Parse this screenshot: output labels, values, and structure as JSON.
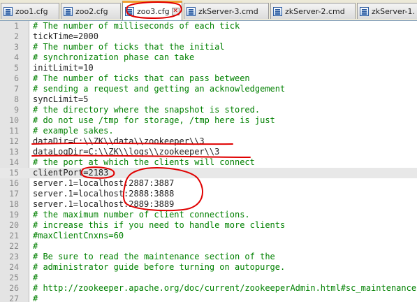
{
  "tabs": [
    {
      "label": "zoo1.cfg",
      "active": false
    },
    {
      "label": "zoo2.cfg",
      "active": false
    },
    {
      "label": "zoo3.cfg",
      "active": true
    },
    {
      "label": "zkServer-3.cmd",
      "active": false
    },
    {
      "label": "zkServer-2.cmd",
      "active": false
    },
    {
      "label": "zkServer-1.",
      "active": false
    }
  ],
  "editor": {
    "current_line": 15,
    "annotation_color": "#e00000",
    "lines": [
      {
        "n": "1",
        "text": "# The number of milliseconds of each tick",
        "comment": true
      },
      {
        "n": "2",
        "text": "tickTime=2000",
        "comment": false
      },
      {
        "n": "3",
        "text": "# The number of ticks that the initial",
        "comment": true
      },
      {
        "n": "4",
        "text": "# synchronization phase can take",
        "comment": true
      },
      {
        "n": "5",
        "text": "initLimit=10",
        "comment": false
      },
      {
        "n": "6",
        "text": "# The number of ticks that can pass between",
        "comment": true
      },
      {
        "n": "7",
        "text": "# sending a request and getting an acknowledgement",
        "comment": true
      },
      {
        "n": "8",
        "text": "syncLimit=5",
        "comment": false
      },
      {
        "n": "9",
        "text": "# the directory where the snapshot is stored.",
        "comment": true
      },
      {
        "n": "10",
        "text": "# do not use /tmp for storage, /tmp here is just",
        "comment": true
      },
      {
        "n": "11",
        "text": "# example sakes.",
        "comment": true
      },
      {
        "n": "12",
        "text": "dataDir=C:\\\\ZK\\\\data\\\\zookeeper\\\\3",
        "comment": false
      },
      {
        "n": "13",
        "text": "dataLogDir=C:\\\\ZK\\\\logs\\\\zookeeper\\\\3",
        "comment": false
      },
      {
        "n": "14",
        "text": "# the port at which the clients will connect",
        "comment": true
      },
      {
        "n": "15",
        "text": "clientPort=2183",
        "comment": false
      },
      {
        "n": "16",
        "text": "server.1=localhost:2887:3887",
        "comment": false
      },
      {
        "n": "17",
        "text": "server.1=localhost:2888:3888",
        "comment": false
      },
      {
        "n": "18",
        "text": "server.1=localhost:2889:3889",
        "comment": false
      },
      {
        "n": "19",
        "text": "# the maximum number of client connections.",
        "comment": true
      },
      {
        "n": "20",
        "text": "# increase this if you need to handle more clients",
        "comment": true
      },
      {
        "n": "21",
        "text": "#maxClientCnxns=60",
        "comment": true
      },
      {
        "n": "22",
        "text": "#",
        "comment": true
      },
      {
        "n": "23",
        "text": "# Be sure to read the maintenance section of the",
        "comment": true
      },
      {
        "n": "24",
        "text": "# administrator guide before turning on autopurge.",
        "comment": true
      },
      {
        "n": "25",
        "text": "#",
        "comment": true
      },
      {
        "n": "26",
        "text": "# http://zookeeper.apache.org/doc/current/zookeeperAdmin.html#sc_maintenance",
        "comment": true
      },
      {
        "n": "27",
        "text": "#",
        "comment": true
      }
    ]
  }
}
